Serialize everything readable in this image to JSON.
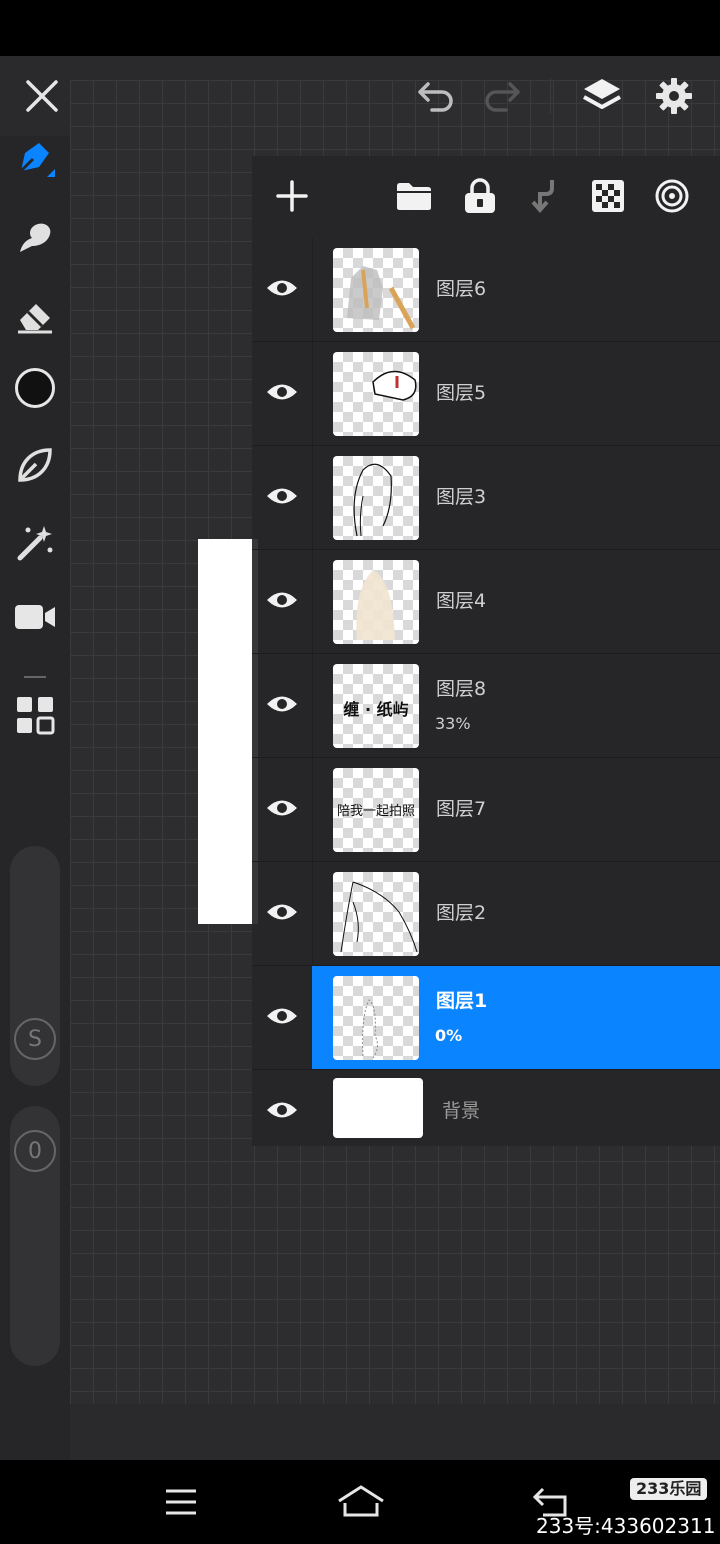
{
  "colors": {
    "accent": "#0a84ff",
    "panel": "#262628",
    "text": "#cfcfcf"
  },
  "topbar": {
    "icons": [
      "close-icon",
      "undo-icon",
      "redo-icon",
      "layers-icon",
      "gear-icon"
    ]
  },
  "sidebar": {
    "tools": [
      "pen-icon",
      "smudge-icon",
      "eraser-icon",
      "color-swatch",
      "leaf-icon",
      "magic-wand-icon",
      "camera-icon",
      "grid-icon"
    ],
    "size_slider_label": "S",
    "opacity_slider_label": "0"
  },
  "panel": {
    "toolbar_icons": [
      "add-icon",
      "folder-icon",
      "lock-icon",
      "merge-down-icon",
      "checker-icon",
      "blend-icon"
    ],
    "layers": [
      {
        "name": "图层6",
        "opacity": "",
        "selected": false
      },
      {
        "name": "图层5",
        "opacity": "",
        "selected": false
      },
      {
        "name": "图层3",
        "opacity": "",
        "selected": false
      },
      {
        "name": "图层4",
        "opacity": "",
        "selected": false
      },
      {
        "name": "图层8",
        "opacity": "33%",
        "selected": false,
        "thumb_text": "缠 · 纸屿"
      },
      {
        "name": "图层7",
        "opacity": "",
        "selected": false,
        "thumb_text": "陪我一起拍照"
      },
      {
        "name": "图层2",
        "opacity": "",
        "selected": false
      },
      {
        "name": "图层1",
        "opacity": "0%",
        "selected": true
      },
      {
        "name": "背景",
        "opacity": "",
        "selected": false
      }
    ]
  },
  "navbar": {
    "icons": [
      "menu-icon",
      "home-icon",
      "back-icon"
    ]
  },
  "watermark": {
    "logo": "233乐园",
    "id": "233号:433602311"
  }
}
